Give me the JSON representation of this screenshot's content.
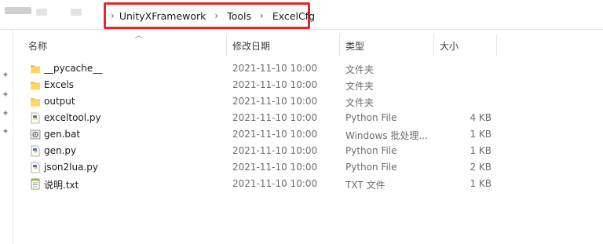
{
  "address_bar": {
    "segments": [
      "UnityXFramework",
      "Tools",
      "ExcelCfg"
    ]
  },
  "columns": {
    "name": "名称",
    "date": "修改日期",
    "type": "类型",
    "size": "大小"
  },
  "files": [
    {
      "name": "__pycache__",
      "date": "2021-11-10 10:00",
      "type": "文件夹",
      "size": "",
      "icon": "folder-icon"
    },
    {
      "name": "Excels",
      "date": "2021-11-10 10:00",
      "type": "文件夹",
      "size": "",
      "icon": "folder-icon"
    },
    {
      "name": "output",
      "date": "2021-11-10 10:00",
      "type": "文件夹",
      "size": "",
      "icon": "folder-icon"
    },
    {
      "name": "exceltool.py",
      "date": "2021-11-10 10:00",
      "type": "Python File",
      "size": "4 KB",
      "icon": "python-file-icon"
    },
    {
      "name": "gen.bat",
      "date": "2021-11-10 10:00",
      "type": "Windows 批处理...",
      "size": "1 KB",
      "icon": "batch-file-icon"
    },
    {
      "name": "gen.py",
      "date": "2021-11-10 10:00",
      "type": "Python File",
      "size": "1 KB",
      "icon": "python-file-icon"
    },
    {
      "name": "json2lua.py",
      "date": "2021-11-10 10:00",
      "type": "Python File",
      "size": "2 KB",
      "icon": "python-file-icon"
    },
    {
      "name": "说明.txt",
      "date": "2021-11-10 10:00",
      "type": "TXT 文件",
      "size": "1 KB",
      "icon": "text-file-icon"
    }
  ],
  "colors": {
    "highlight_border": "#e1262c",
    "folder": "#f5c443",
    "python_blue": "#3a75b0",
    "python_yellow": "#f5d04a"
  }
}
